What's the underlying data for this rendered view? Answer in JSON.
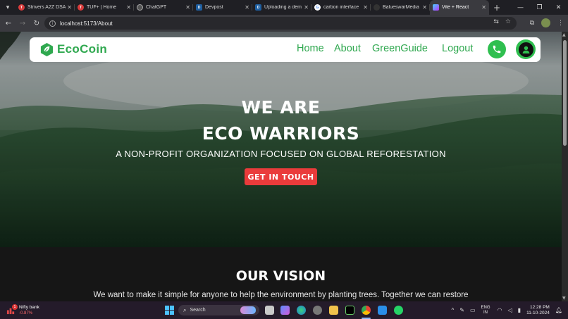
{
  "browser": {
    "tabs": [
      {
        "label": "Strivers A2Z DSA",
        "favicon": "tuf-icon",
        "color": "#d93b3b"
      },
      {
        "label": "TUF+ | Home",
        "favicon": "tuf-icon",
        "color": "#d93b3b"
      },
      {
        "label": "ChatGPT",
        "favicon": "chatgpt-icon",
        "color": "#555555"
      },
      {
        "label": "Devpost",
        "favicon": "devpost-icon",
        "color": "#1f5fa0"
      },
      {
        "label": "Uploading a dem",
        "favicon": "devpost-icon",
        "color": "#1f5fa0"
      },
      {
        "label": "carbon interface",
        "favicon": "google-icon",
        "color": "#ffffff"
      },
      {
        "label": "BalueswarMedia",
        "favicon": "web-icon",
        "color": "#333333"
      },
      {
        "label": "Vite + React",
        "favicon": "vite-icon",
        "color": "#a36bff"
      }
    ],
    "active_tab": 7,
    "url": "localhost:5173/About"
  },
  "site": {
    "brand": "EcoCoin",
    "nav": [
      "Home",
      "About",
      "GreenGuide",
      "Logout"
    ],
    "hero_line1": "WE ARE",
    "hero_line2": "ECO WARRIORS",
    "hero_subtitle": "A NON-PROFIT ORGANIZATION FOCUSED ON GLOBAL REFORESTATION",
    "cta_label": "GET IN TOUCH",
    "vision_title": "OUR VISION",
    "vision_text": "We want to make it simple for anyone to help the environment by planting trees. Together we can restore"
  },
  "taskbar": {
    "stock_name": "Nifty bank",
    "stock_change": "-0.87%",
    "notification_count": "1",
    "search_placeholder": "Search",
    "lang_line1": "ENG",
    "lang_line2": "IN",
    "time": "12:28 PM",
    "date": "11-10-2024"
  },
  "colors": {
    "brand_green": "#2fa84f",
    "cta_red": "#ea3b3b",
    "button_green": "#2fbf4f"
  }
}
